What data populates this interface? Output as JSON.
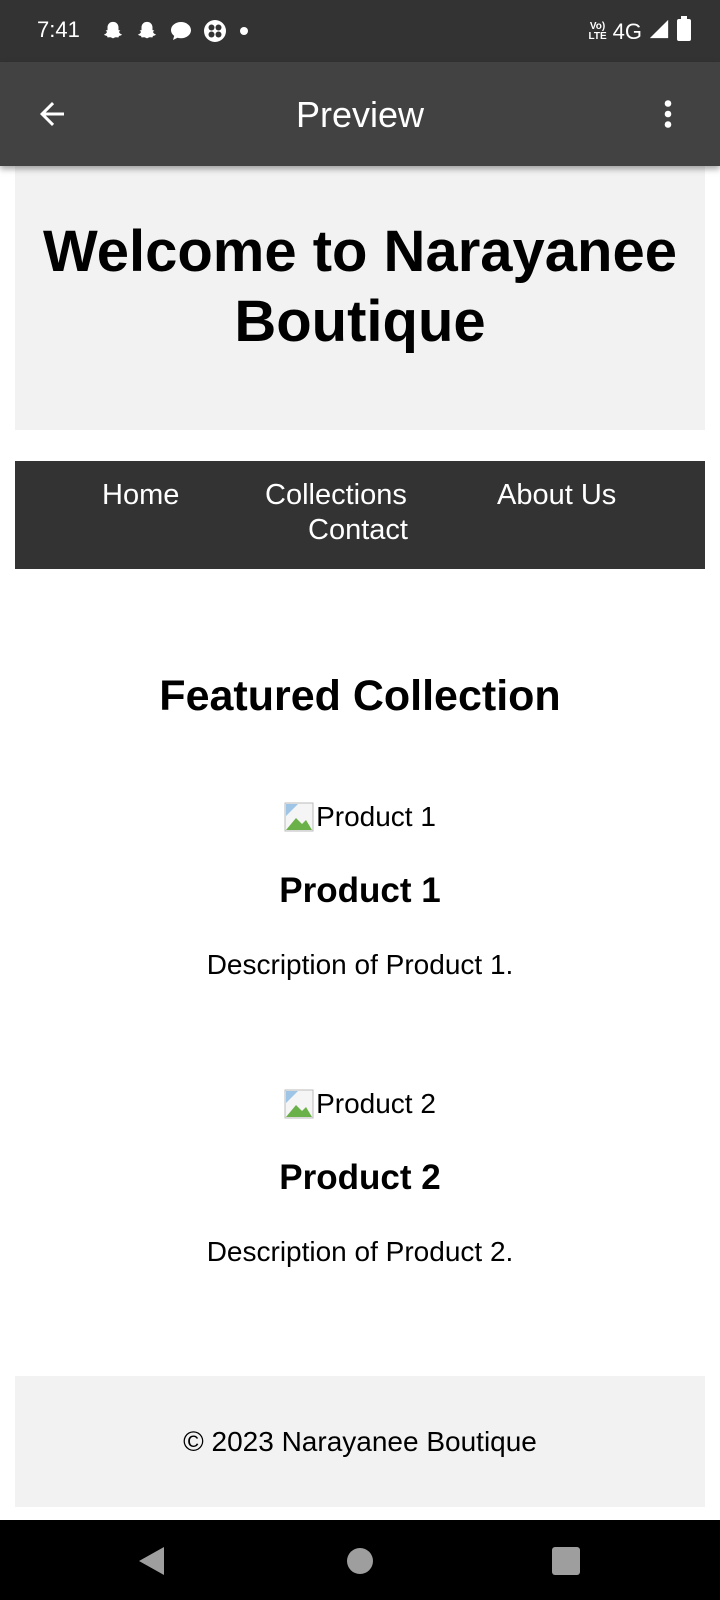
{
  "status_bar": {
    "time": "7:41",
    "left_icons": [
      "snapchat-icon",
      "snapchat-icon",
      "chat-bubble-icon",
      "clover-app-icon",
      "notification-dot"
    ],
    "network": "4G",
    "volte_label": "Vo LTE",
    "right_icons": [
      "signal-icon",
      "battery-icon"
    ]
  },
  "app_bar": {
    "title": "Preview",
    "back_icon": "arrow-left-icon",
    "more_icon": "more-vert-icon"
  },
  "hero": {
    "title": "Welcome to Narayanee Boutique"
  },
  "nav": {
    "items": [
      {
        "label": "Home"
      },
      {
        "label": "Collections"
      },
      {
        "label": "About Us"
      },
      {
        "label": "Contact"
      }
    ]
  },
  "featured": {
    "title": "Featured Collection",
    "products": [
      {
        "image_alt": "Product 1",
        "name": "Product 1",
        "description": "Description of Product 1."
      },
      {
        "image_alt": "Product 2",
        "name": "Product 2",
        "description": "Description of Product 2."
      }
    ]
  },
  "footer": {
    "text": "© 2023 Narayanee Boutique"
  },
  "colors": {
    "status_bar": "#333333",
    "app_bar": "#424242",
    "hero_bg": "#f2f2f2",
    "nav_bg": "#333333",
    "footer_bg": "#f2f2f2"
  }
}
